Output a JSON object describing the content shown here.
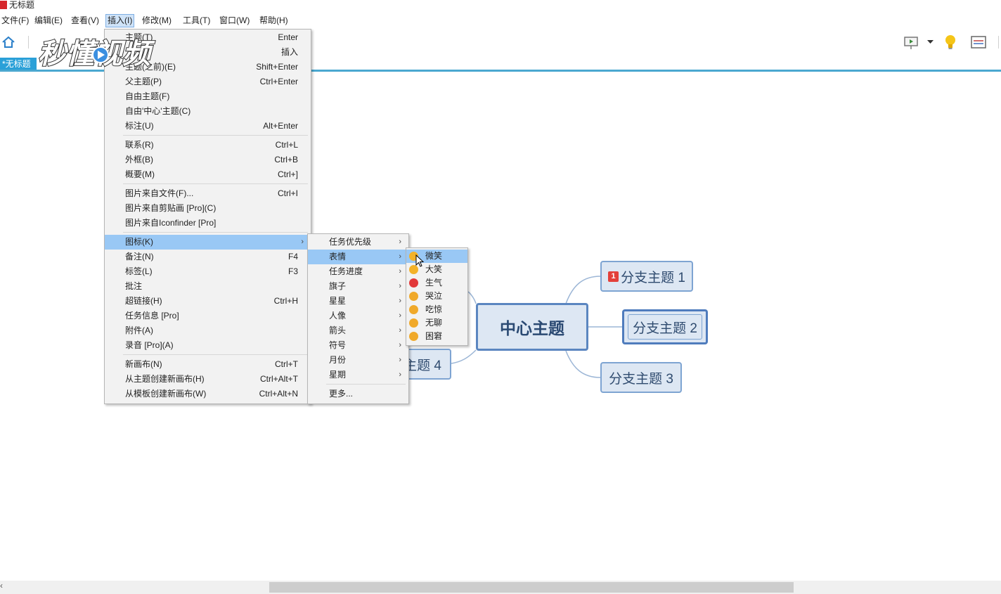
{
  "window": {
    "title": "无标题"
  },
  "menubar": {
    "items": [
      "文件(F)",
      "编辑(E)",
      "查看(V)",
      "插入(I)",
      "修改(M)",
      "工具(T)",
      "窗口(W)",
      "帮助(H)"
    ],
    "active": "插入(I)"
  },
  "toolbar": {
    "icons": [
      "home-icon",
      "presentation-icon",
      "lightbulb-icon",
      "panel-icon"
    ]
  },
  "watermark": {
    "text": "秒懂视频"
  },
  "doc_tab": {
    "label": "*无标题"
  },
  "insert_menu": {
    "items": [
      {
        "label": "主题(T)",
        "shortcut": "Enter"
      },
      {
        "label": "",
        "shortcut": "插入"
      },
      {
        "label": "主题(之前)(E)",
        "shortcut": "Shift+Enter"
      },
      {
        "label": "父主题(P)",
        "shortcut": "Ctrl+Enter"
      },
      {
        "label": "自由主题(F)",
        "shortcut": ""
      },
      {
        "label": "自由'中心'主题(C)",
        "shortcut": ""
      },
      {
        "label": "标注(U)",
        "shortcut": "Alt+Enter"
      },
      {
        "label": "联系(R)",
        "shortcut": "Ctrl+L"
      },
      {
        "label": "外框(B)",
        "shortcut": "Ctrl+B"
      },
      {
        "label": "概要(M)",
        "shortcut": "Ctrl+]"
      },
      {
        "label": "图片来自文件(F)...",
        "shortcut": "Ctrl+I"
      },
      {
        "label": "图片来自剪贴画 [Pro](C)",
        "shortcut": ""
      },
      {
        "label": "图片来自Iconfinder [Pro]",
        "shortcut": ""
      },
      {
        "label": "图标(K)",
        "shortcut": ""
      },
      {
        "label": "备注(N)",
        "shortcut": "F4"
      },
      {
        "label": "标签(L)",
        "shortcut": "F3"
      },
      {
        "label": "批注",
        "shortcut": ""
      },
      {
        "label": "超链接(H)",
        "shortcut": "Ctrl+H"
      },
      {
        "label": "任务信息 [Pro]",
        "shortcut": ""
      },
      {
        "label": "附件(A)",
        "shortcut": ""
      },
      {
        "label": "录音 [Pro](A)",
        "shortcut": ""
      },
      {
        "label": "新画布(N)",
        "shortcut": "Ctrl+T"
      },
      {
        "label": "从主题创建新画布(H)",
        "shortcut": "Ctrl+Alt+T"
      },
      {
        "label": "从模板创建新画布(W)",
        "shortcut": "Ctrl+Alt+N"
      }
    ]
  },
  "icons_menu": {
    "items": [
      "任务优先级",
      "表情",
      "任务进度",
      "旗子",
      "星星",
      "人像",
      "箭头",
      "符号",
      "月份",
      "星期",
      "更多..."
    ]
  },
  "emotion_menu": {
    "items": [
      {
        "label": "微笑",
        "color": "#f3b229"
      },
      {
        "label": "大笑",
        "color": "#f3b229"
      },
      {
        "label": "生气",
        "color": "#e2393a"
      },
      {
        "label": "哭泣",
        "color": "#f0a92a"
      },
      {
        "label": "吃惊",
        "color": "#f0a92a"
      },
      {
        "label": "无聊",
        "color": "#f0a92a"
      },
      {
        "label": "困窘",
        "color": "#f0a92a"
      }
    ]
  },
  "mindmap": {
    "central": "中心主题",
    "branches": [
      "分支主题 1",
      "分支主题 2",
      "分支主题 3",
      "主题 4"
    ],
    "priority_badge": "1"
  },
  "colors": {
    "accent": "#4aa8d0",
    "highlight": "#99c8f5",
    "topic_border": "#5b86c0"
  }
}
